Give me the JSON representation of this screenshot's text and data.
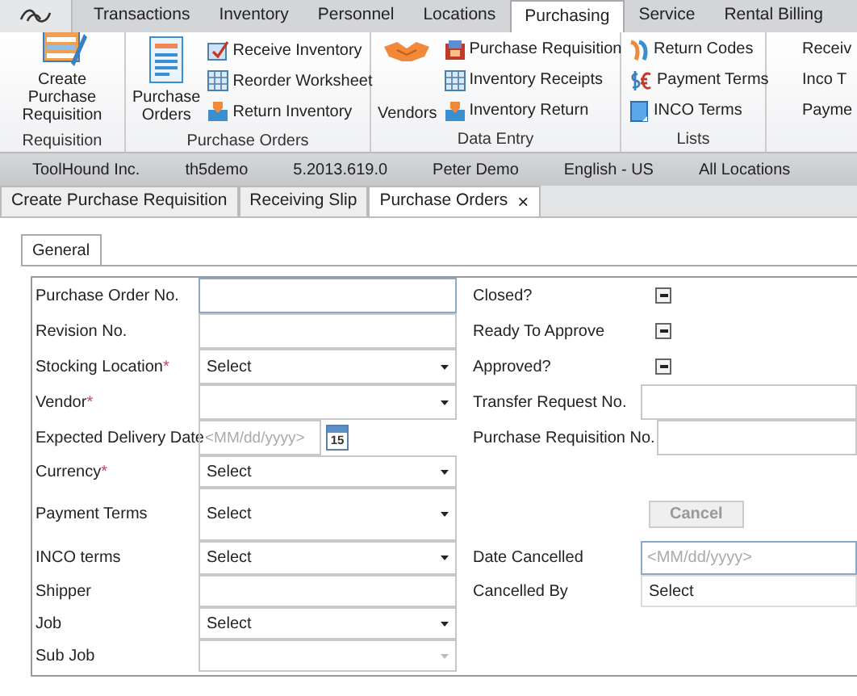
{
  "menu_tabs": [
    {
      "label": "Transactions",
      "selected": false
    },
    {
      "label": "Inventory",
      "selected": false
    },
    {
      "label": "Personnel",
      "selected": false
    },
    {
      "label": "Locations",
      "selected": false
    },
    {
      "label": "Purchasing",
      "selected": true
    },
    {
      "label": "Service",
      "selected": false
    },
    {
      "label": "Rental Billing",
      "selected": false
    }
  ],
  "ribbon": {
    "groups": [
      {
        "label": "Requisition",
        "large": [
          {
            "label": "Create Purchase Requisition"
          }
        ]
      },
      {
        "label": "Purchase Orders",
        "large": [
          {
            "label": "Purchase Orders"
          }
        ],
        "small": [
          {
            "label": "Receive Inventory"
          },
          {
            "label": "Reorder Worksheet"
          },
          {
            "label": "Return Inventory"
          }
        ]
      },
      {
        "label": "Data Entry",
        "large": [
          {
            "label": "Vendors"
          }
        ],
        "small": [
          {
            "label": "Purchase Requisition"
          },
          {
            "label": "Inventory Receipts"
          },
          {
            "label": "Inventory Return"
          }
        ]
      },
      {
        "label": "Lists",
        "small": [
          {
            "label": "Return Codes"
          },
          {
            "label": "Payment Terms"
          },
          {
            "label": "INCO Terms"
          }
        ]
      },
      {
        "small": [
          {
            "label": "Receiv"
          },
          {
            "label": "Inco T"
          },
          {
            "label": "Payme"
          }
        ]
      }
    ]
  },
  "status_bar": [
    "ToolHound Inc.",
    "th5demo",
    "5.2013.619.0",
    "Peter Demo",
    "English - US",
    "All Locations"
  ],
  "doc_tabs": [
    {
      "label": "Create Purchase Requisition",
      "selected": false
    },
    {
      "label": "Receiving Slip",
      "selected": false
    },
    {
      "label": "Purchase Orders",
      "selected": true,
      "close": "×"
    }
  ],
  "form": {
    "tabs": [
      {
        "label": "General",
        "selected": true
      }
    ],
    "rows": [
      {
        "left": {
          "label": "Purchase Order No.",
          "kind": "text",
          "focused": true
        },
        "right": {
          "label": "Closed?",
          "kind": "checkbox",
          "indeterminate": true
        }
      },
      {
        "left": {
          "label": "Revision No.",
          "kind": "text"
        },
        "right": {
          "label": "Ready To Approve",
          "kind": "checkbox",
          "indeterminate": true
        }
      },
      {
        "left": {
          "label": "Stocking Location",
          "mark": "*",
          "kind": "select",
          "value": "Select",
          "disabled": false
        },
        "right": {
          "label": "Approved?",
          "kind": "checkbox",
          "indeterminate": true
        }
      },
      {
        "left": {
          "label": "Vendor",
          "mark": "*",
          "kind": "select",
          "disabled": false
        },
        "right": {
          "label": "Transfer Request No.",
          "kind": "text"
        }
      },
      {
        "left": {
          "label": "Expected Delivery Date",
          "kind": "date",
          "placeholder": "<MM/dd/yyyy>",
          "calendar": "15"
        },
        "right": {
          "label": "Purchase Requisition No.",
          "kind": "text"
        }
      },
      {
        "left": {
          "label": "Currency",
          "mark": "*",
          "kind": "select",
          "value": "Select",
          "disabled": false
        },
        "right": {
          "kind": "empty"
        }
      },
      {
        "left": {
          "label": "Payment Terms",
          "kind": "select",
          "value": "Select",
          "disabled": false
        },
        "right": {
          "kind": "button",
          "label": "Cancel",
          "disabled": true
        }
      },
      {
        "left": {
          "label": "INCO terms",
          "kind": "select",
          "value": "Select",
          "disabled": false
        },
        "right": {
          "label": "Date Cancelled",
          "kind": "text",
          "placeholder": "<MM/dd/yyyy>",
          "focused": true
        }
      },
      {
        "left": {
          "label": "Shipper",
          "kind": "text"
        },
        "right": {
          "label": "Cancelled By",
          "kind": "plain",
          "value": "Select"
        }
      },
      {
        "left": {
          "label": "Job",
          "kind": "select",
          "value": "Select",
          "disabled": false
        },
        "right": {
          "kind": "empty"
        }
      },
      {
        "left": {
          "label": "Sub Job",
          "kind": "select",
          "disabled": true
        },
        "right": {
          "kind": "empty"
        }
      }
    ]
  }
}
